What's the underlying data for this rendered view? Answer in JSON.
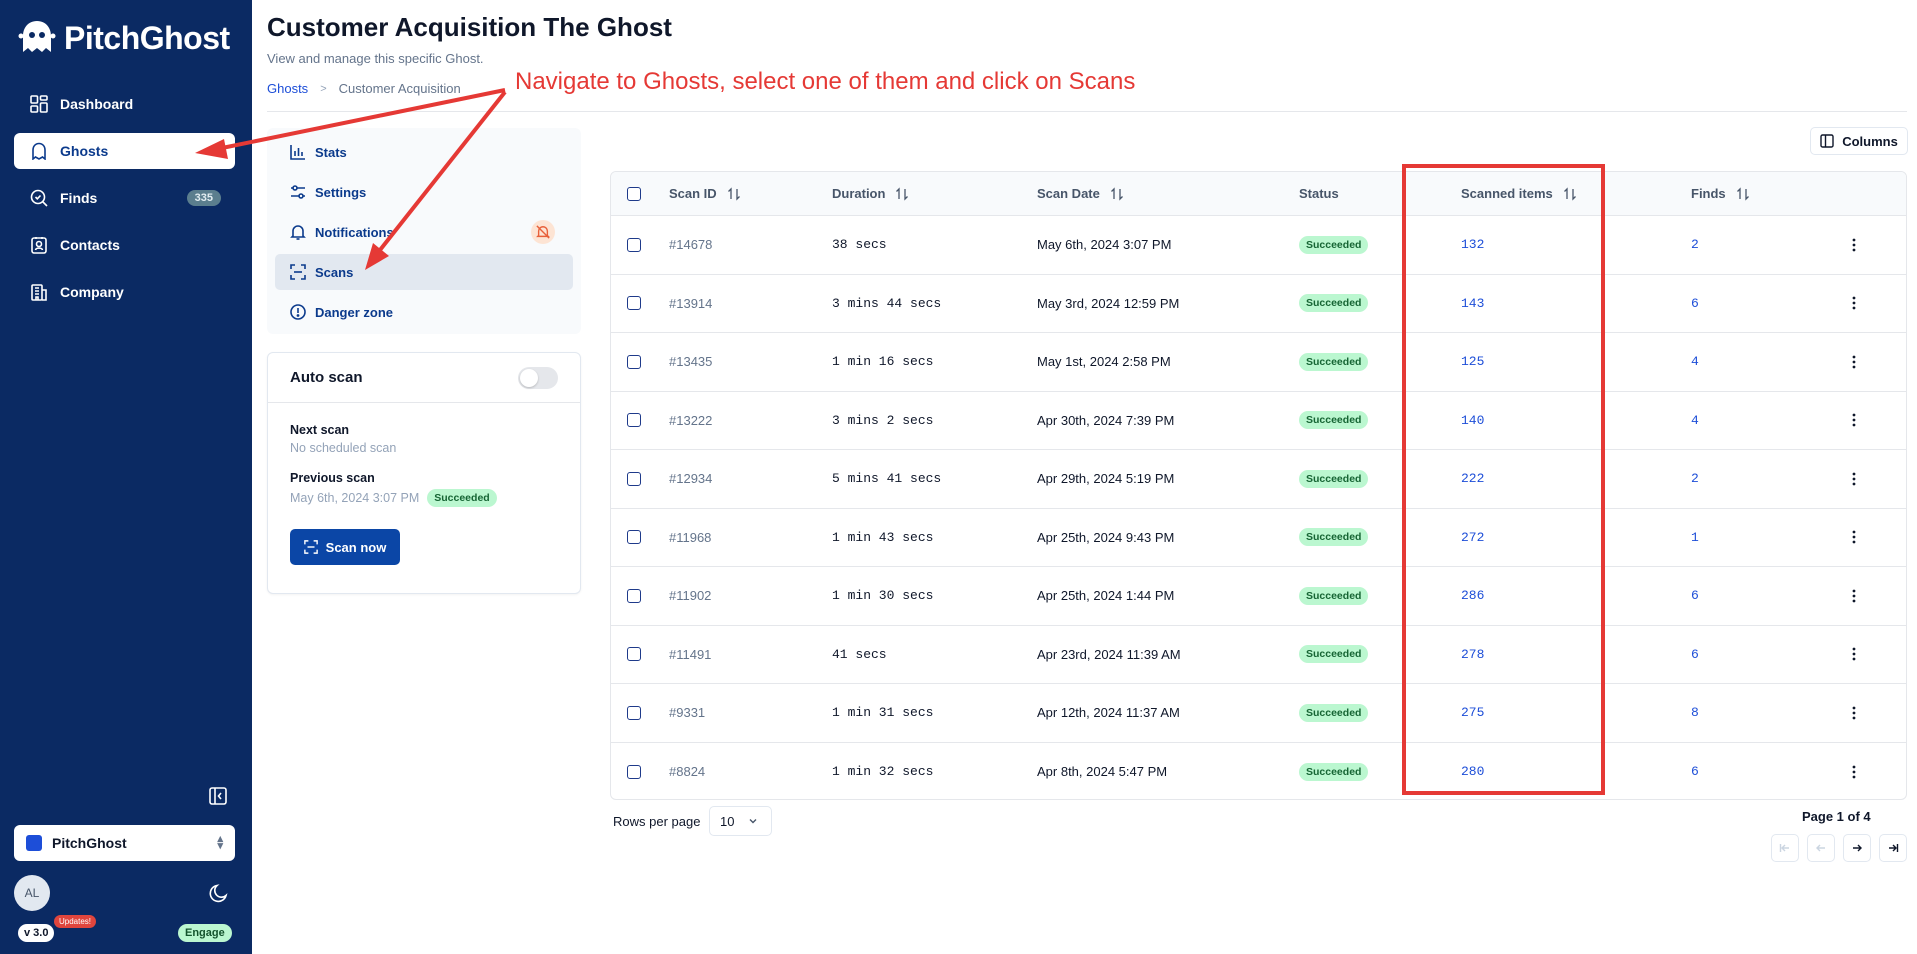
{
  "app": {
    "name": "PitchGhost"
  },
  "sidebar": {
    "items": [
      {
        "label": "Dashboard",
        "icon": "dashboard-icon"
      },
      {
        "label": "Ghosts",
        "icon": "ghost-icon",
        "active": true
      },
      {
        "label": "Finds",
        "icon": "search-check-icon",
        "badge": "335"
      },
      {
        "label": "Contacts",
        "icon": "contact-icon"
      },
      {
        "label": "Company",
        "icon": "building-icon"
      }
    ],
    "org_name": "PitchGhost",
    "avatar_initials": "AL",
    "version": "v 3.0",
    "updates_label": "Updates!",
    "engage_label": "Engage"
  },
  "header": {
    "title": "Customer Acquisition The Ghost",
    "subtitle": "View and manage this specific Ghost.",
    "breadcrumb": [
      "Ghosts",
      "Customer Acquisition"
    ]
  },
  "settings_menu": [
    {
      "label": "Stats",
      "icon": "chart-icon"
    },
    {
      "label": "Settings",
      "icon": "sliders-icon"
    },
    {
      "label": "Notifications",
      "icon": "bell-icon"
    },
    {
      "label": "Scans",
      "icon": "scan-icon",
      "active": true
    },
    {
      "label": "Danger zone",
      "icon": "alert-circle-icon"
    }
  ],
  "auto_scan": {
    "title": "Auto scan",
    "enabled": false,
    "next_label": "Next scan",
    "next_value": "No scheduled scan",
    "prev_label": "Previous scan",
    "prev_value": "May 6th, 2024 3:07 PM",
    "prev_status": "Succeeded",
    "button_label": "Scan now"
  },
  "table": {
    "columns_button": "Columns",
    "headers": [
      "Scan ID",
      "Duration",
      "Scan Date",
      "Status",
      "Scanned items",
      "Finds"
    ],
    "rows": [
      {
        "id": "#14678",
        "duration": "38 secs",
        "date": "May 6th, 2024 3:07 PM",
        "status": "Succeeded",
        "scanned": "132",
        "finds": "2"
      },
      {
        "id": "#13914",
        "duration": "3 mins 44 secs",
        "date": "May 3rd, 2024 12:59 PM",
        "status": "Succeeded",
        "scanned": "143",
        "finds": "6"
      },
      {
        "id": "#13435",
        "duration": "1 min 16 secs",
        "date": "May 1st, 2024 2:58 PM",
        "status": "Succeeded",
        "scanned": "125",
        "finds": "4"
      },
      {
        "id": "#13222",
        "duration": "3 mins 2 secs",
        "date": "Apr 30th, 2024 7:39 PM",
        "status": "Succeeded",
        "scanned": "140",
        "finds": "4"
      },
      {
        "id": "#12934",
        "duration": "5 mins 41 secs",
        "date": "Apr 29th, 2024 5:19 PM",
        "status": "Succeeded",
        "scanned": "222",
        "finds": "2"
      },
      {
        "id": "#11968",
        "duration": "1 min 43 secs",
        "date": "Apr 25th, 2024 9:43 PM",
        "status": "Succeeded",
        "scanned": "272",
        "finds": "1"
      },
      {
        "id": "#11902",
        "duration": "1 min 30 secs",
        "date": "Apr 25th, 2024 1:44 PM",
        "status": "Succeeded",
        "scanned": "286",
        "finds": "6"
      },
      {
        "id": "#11491",
        "duration": "41 secs",
        "date": "Apr 23rd, 2024 11:39 AM",
        "status": "Succeeded",
        "scanned": "278",
        "finds": "6"
      },
      {
        "id": "#9331",
        "duration": "1 min 31 secs",
        "date": "Apr 12th, 2024 11:37 AM",
        "status": "Succeeded",
        "scanned": "275",
        "finds": "8"
      },
      {
        "id": "#8824",
        "duration": "1 min 32 secs",
        "date": "Apr 8th, 2024 5:47 PM",
        "status": "Succeeded",
        "scanned": "280",
        "finds": "6"
      }
    ]
  },
  "pagination": {
    "rows_per_page_label": "Rows per page",
    "rows_per_page": "10",
    "page_info": "Page 1 of 4"
  },
  "annotation": {
    "text": "Navigate to Ghosts, select one of them and click on Scans",
    "color": "#e53935"
  },
  "colors": {
    "sidebar_bg": "#0b2a63",
    "accent": "#0b46a6",
    "link": "#1d4ed8",
    "success_bg": "#bbf7d0"
  }
}
